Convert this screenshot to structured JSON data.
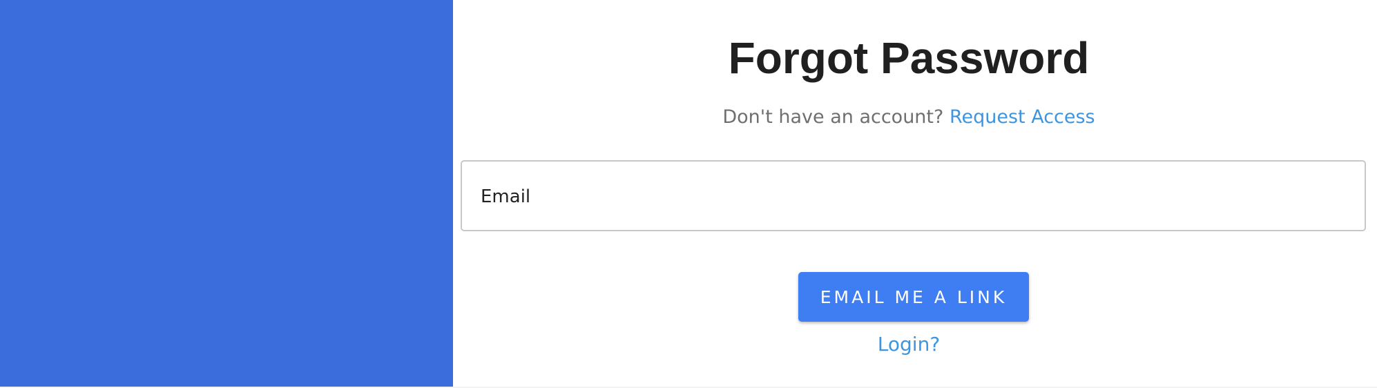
{
  "page": {
    "title": "Forgot Password",
    "subtitle_text": "Don't have an account?",
    "request_access_label": "Request Access",
    "email_label": "Email",
    "submit_label": "EMAIL ME A LINK",
    "login_label": "Login?"
  },
  "colors": {
    "brand_panel": "#3b6edc",
    "primary_button": "#3f7df3",
    "link": "#3d95e0",
    "title_text": "#202020",
    "muted_text": "#6f6f6f"
  }
}
